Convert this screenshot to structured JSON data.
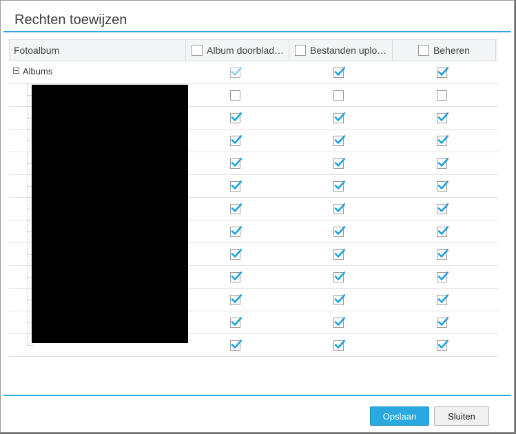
{
  "dialog": {
    "title": "Rechten toewijzen"
  },
  "grid": {
    "columns": [
      {
        "label": "Fotoalbum",
        "has_checkbox": false
      },
      {
        "label": "Album doorblad…",
        "has_checkbox": true
      },
      {
        "label": "Bestanden uplo…",
        "has_checkbox": true
      },
      {
        "label": "Beheren",
        "has_checkbox": true
      }
    ],
    "root_row": {
      "label": "Albums",
      "checks": [
        "partial",
        "checked",
        "checked"
      ]
    },
    "child_rows": [
      {
        "checks": [
          "unchecked",
          "unchecked",
          "unchecked"
        ]
      },
      {
        "checks": [
          "checked",
          "checked",
          "checked"
        ]
      },
      {
        "checks": [
          "checked",
          "checked",
          "checked"
        ]
      },
      {
        "checks": [
          "checked",
          "checked",
          "checked"
        ]
      },
      {
        "checks": [
          "checked",
          "checked",
          "checked"
        ]
      },
      {
        "checks": [
          "checked",
          "checked",
          "checked"
        ]
      },
      {
        "checks": [
          "checked",
          "checked",
          "checked"
        ]
      },
      {
        "checks": [
          "checked",
          "checked",
          "checked"
        ]
      },
      {
        "checks": [
          "checked",
          "checked",
          "checked"
        ]
      },
      {
        "checks": [
          "checked",
          "checked",
          "checked"
        ]
      },
      {
        "checks": [
          "checked",
          "checked",
          "checked"
        ]
      },
      {
        "checks": [
          "checked",
          "checked",
          "checked"
        ]
      }
    ]
  },
  "footer": {
    "save_label": "Opslaan",
    "close_label": "Sluiten"
  },
  "colors": {
    "accent": "#2aa9e0",
    "check": "#1ba1e2",
    "check_partial": "#8fd0ef"
  }
}
